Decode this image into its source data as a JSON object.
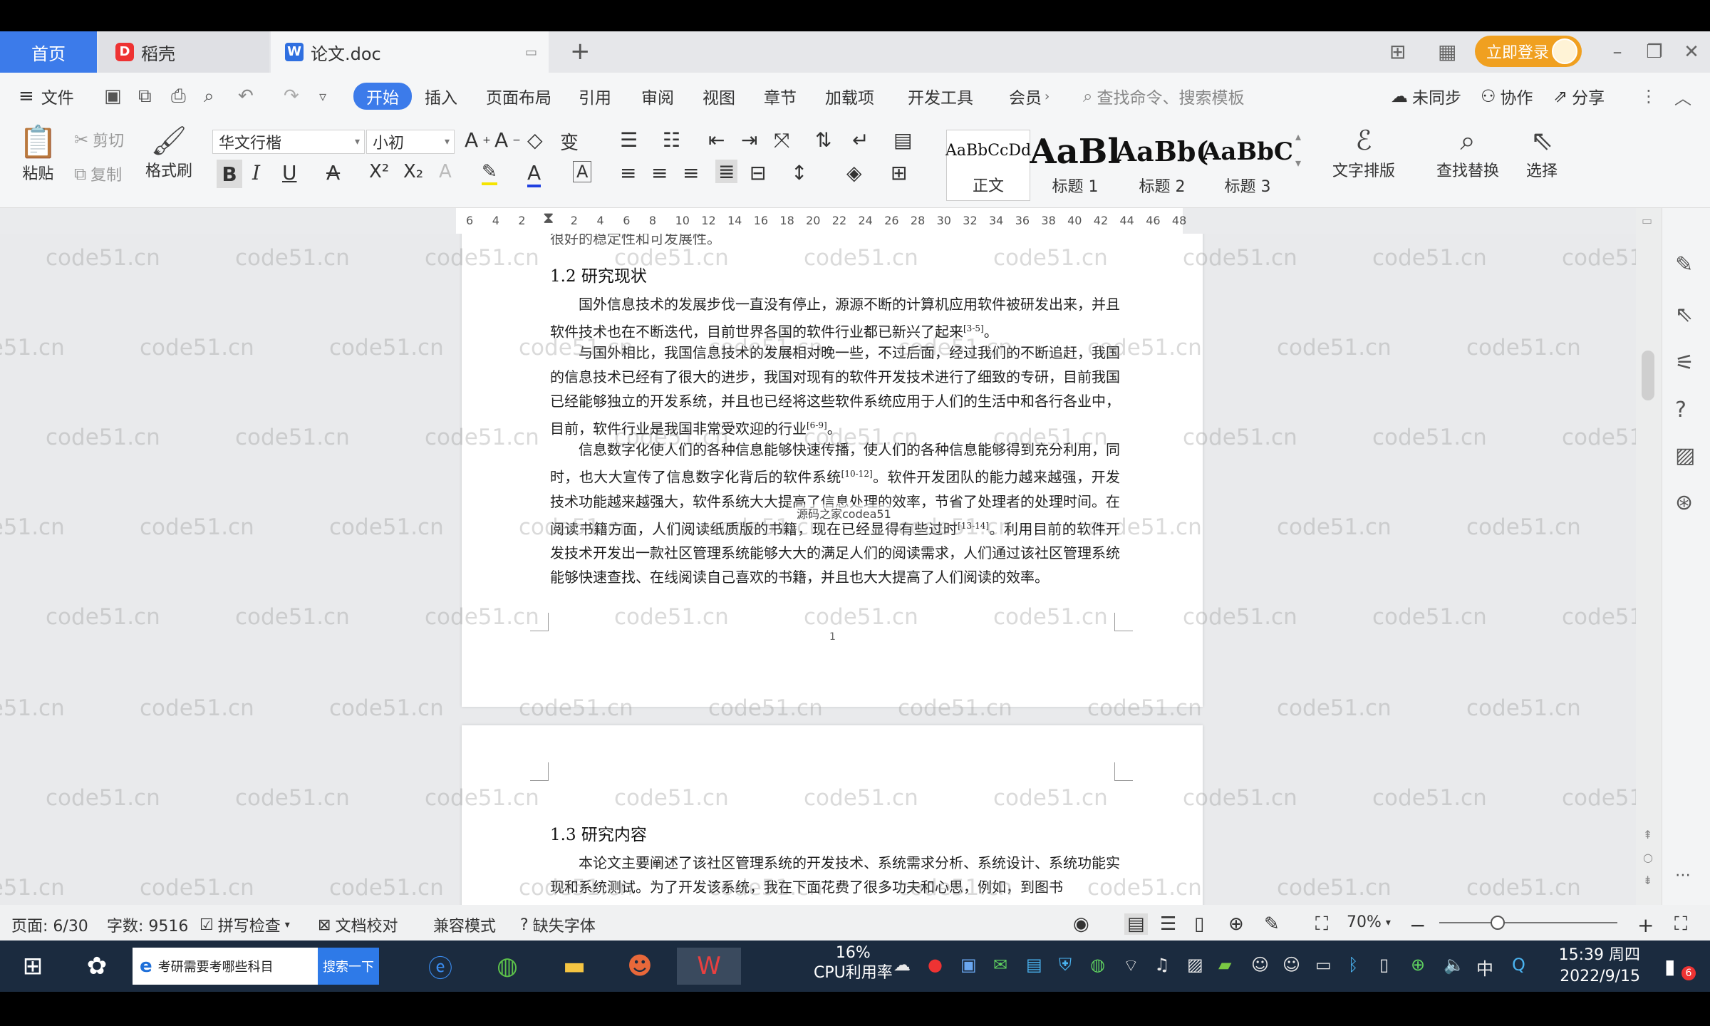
{
  "titlebar": {
    "tab_home": "首页",
    "tab_daoke": "稻壳",
    "tab_doc": "论文.doc",
    "login": "立即登录"
  },
  "menu": {
    "file": "文件",
    "items": [
      "开始",
      "插入",
      "页面布局",
      "引用",
      "审阅",
      "视图",
      "章节",
      "加载项",
      "开发工具",
      "会员"
    ],
    "search_placeholder": "查找命令、搜索模板",
    "sync": "未同步",
    "collab": "协作",
    "share": "分享"
  },
  "ribbon": {
    "paste": "粘贴",
    "cut": "剪切",
    "copy": "复制",
    "format_painter": "格式刷",
    "font_name": "华文行楷",
    "font_size": "小初",
    "styles": [
      {
        "sample": "AaBbCcDd",
        "label": "正文"
      },
      {
        "sample": "AaBl",
        "label": "标题 1"
      },
      {
        "sample": "AaBb(",
        "label": "标题 2"
      },
      {
        "sample": "AaBbC",
        "label": "标题 3"
      }
    ],
    "text_layout": "文字排版",
    "find_replace": "查找替换",
    "select": "选择"
  },
  "ruler": {
    "ticks": [
      "6",
      "4",
      "2",
      "",
      "2",
      "4",
      "6",
      "8",
      "10",
      "12",
      "14",
      "16",
      "18",
      "20",
      "22",
      "24",
      "26",
      "28",
      "30",
      "32",
      "34",
      "36",
      "38",
      "40",
      "42",
      "44",
      "46",
      "48"
    ]
  },
  "document": {
    "top_cut_line": "很好的稳定性和可发展性。",
    "section_12": "1.2  研究现状",
    "p1": "国外信息技术的发展步伐一直没有停止，源源不断的计算机应用软件被研发出来，并且软件技术也在不断迭代，目前世界各国的软件行业都已新兴了起来",
    "p1_ref": "[3-5]",
    "p1_end": "。",
    "p2": "与国外相比，我国信息技术的发展相对晚一些，不过后面，经过我们的不断追赶，我国的信息技术已经有了很大的进步，我国对现有的软件开发技术进行了细致的专研，目前我国已经能够独立的开发系统，并且也已经将这些软件系统应用于人们的生活中和各行各业中，目前，软件行业是我国非常受欢迎的行业",
    "p2_ref": "[6-9]",
    "p2_end": "。",
    "p3a": "信息数字化使人们的各种信息能够快速传播，使人们的各种信息能够得到充分利用，同时，也大大宣传了信息数字化背后的软件系统",
    "p3_ref1": "[10-12]",
    "p3b": "。软件开发团队的能力越来越强，开发技术功能越来越强大，软件系统大大提高了信息处理的效率，节省了处理者的处理时间。在阅读书籍方面，人们阅读纸质版的书籍，现在已经显得有些过时",
    "p3_ref2": "[13-14]",
    "p3c": "。利用目前的软件开发技术开发出一款社区管理系统能够大大的满足人们的阅读需求，人们通过该社区管理系统能够快速查找、在线阅读自己喜欢的书籍，并且也大大提高了人们阅读的效率。",
    "overlay_source": "源码之家codea51",
    "page_number": "1",
    "section_13": "1.3  研究内容",
    "p4": "本论文主要阐述了该社区管理系统的开发技术、系统需求分析、系统设计、系统功能实现和系统测试。为了开发该系统，我在下面花费了很多功夫和心思，例如，到图书",
    "watermark": "code51.cn"
  },
  "statusbar": {
    "page": "页面: 6/30",
    "words": "字数: 9516",
    "spell": "拼写检查",
    "proof": "文档校对",
    "compat": "兼容模式",
    "missing_font": "缺失字体",
    "zoom": "70%"
  },
  "taskbar": {
    "search_text": "考研需要考哪些科目",
    "search_btn": "搜索一下",
    "cpu_pct": "16%",
    "cpu_label": "CPU利用率",
    "ime": "中",
    "time": "15:39 周四",
    "date": "2022/9/15",
    "notify_count": "6"
  },
  "colors": {
    "accent": "#3c7bea",
    "login": "#f0a020",
    "taskbar": "#1b2b3f"
  }
}
